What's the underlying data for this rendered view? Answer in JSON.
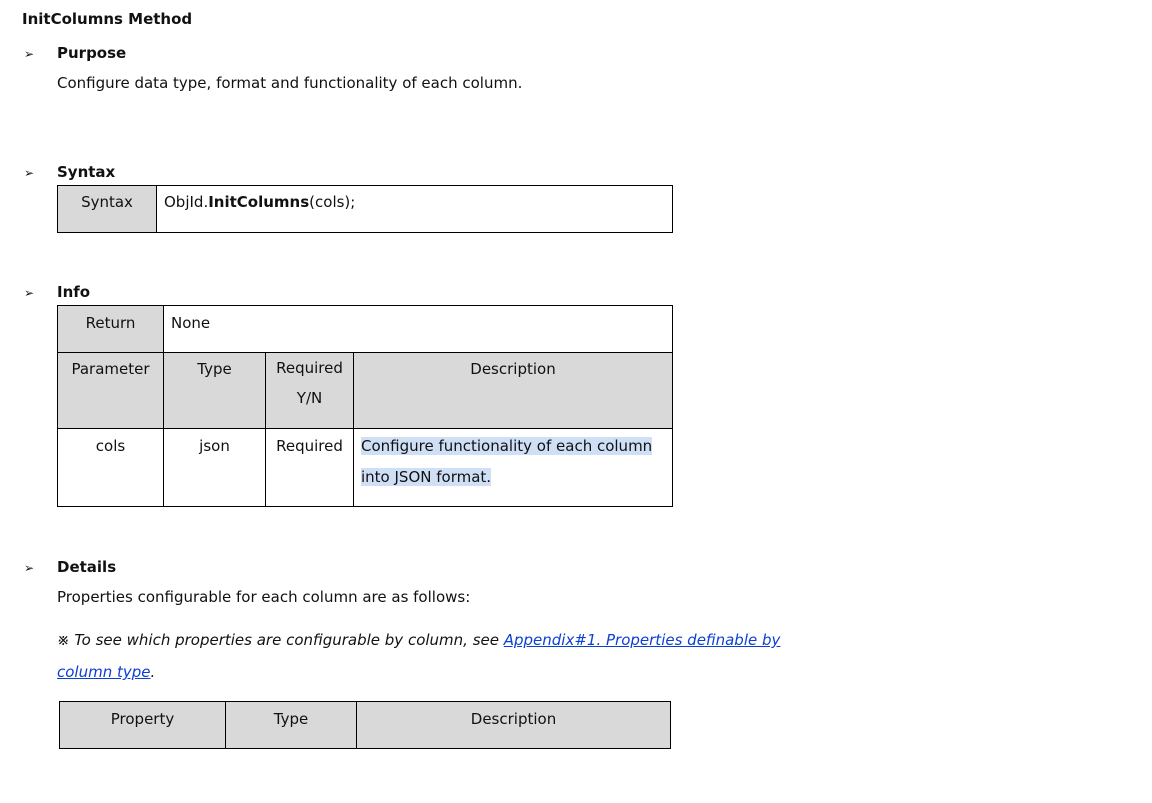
{
  "title": "InitColumns Method",
  "bullet": "➢",
  "purpose": {
    "heading": "Purpose",
    "text": "Configure data type, format and functionality of each column."
  },
  "syntax": {
    "heading": "Syntax",
    "label": "Syntax",
    "obj": "ObjId.",
    "method": "InitColumns",
    "args": "(cols);"
  },
  "info": {
    "heading": "Info",
    "return_label": "Return",
    "return_value": "None",
    "headers": {
      "parameter": "Parameter",
      "type": "Type",
      "required_line1": "Required",
      "required_line2": "Y/N",
      "description": "Description"
    },
    "rows": [
      {
        "parameter": "cols",
        "type": "json",
        "required": "Required",
        "description_line1": "Configure functionality of each column",
        "description_line2": "into JSON format."
      }
    ]
  },
  "details": {
    "heading": "Details",
    "text": "Properties configurable for each column are as follows:",
    "note_prefix": "※ To see which properties are configurable by column, see ",
    "link_line1": "Appendix#1. Properties definable by",
    "link_line2": "column type",
    "note_suffix": ".",
    "table_headers": {
      "property": "Property",
      "type": "Type",
      "description": "Description"
    }
  }
}
